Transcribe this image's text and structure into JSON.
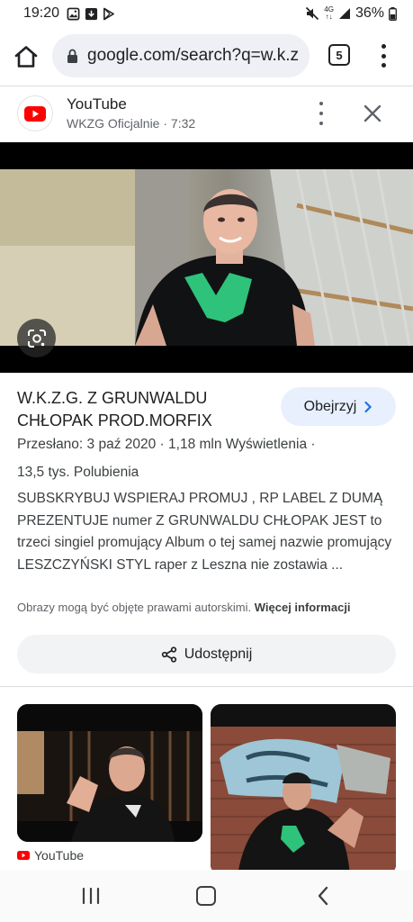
{
  "status_bar": {
    "time": "19:20",
    "network": "4G",
    "battery": "36%"
  },
  "browser": {
    "url": "google.com/search?q=w.k.z",
    "tab_count": "5"
  },
  "result": {
    "source_name": "YouTube",
    "source_subtitle": "WKZG Oficjalnie · 7:32",
    "title": "W.K.Z.G. Z GRUNWALDU CHŁOPAK PROD.MORFIX",
    "watch_label": "Obejrzyj",
    "meta_line1": "Przesłano: 3 paź 2020  ·  1,18 mln Wyświetlenia  ·",
    "meta_line2": "13,5 tys. Polubienia",
    "description": "SUBSKRYBUJ WSPIERAJ PROMUJ , RP LABEL Z DUMĄ PREZENTUJE numer Z GRUNWALDU CHŁOPAK JEST to trzeci singiel promujący Album o tej samej nazwie promujący LESZCZYŃSKI STYL raper z Leszna nie zostawia ...",
    "copyright_text": "Obrazy mogą być objęte prawami autorskimi.",
    "copyright_link": "Więcej informacji",
    "share_label": "Udostępnij"
  },
  "related": {
    "source_name": "YouTube"
  },
  "colors": {
    "youtube_red": "#ff0000",
    "watch_bg": "#e8f0fe",
    "link_blue": "#1a73e8"
  }
}
